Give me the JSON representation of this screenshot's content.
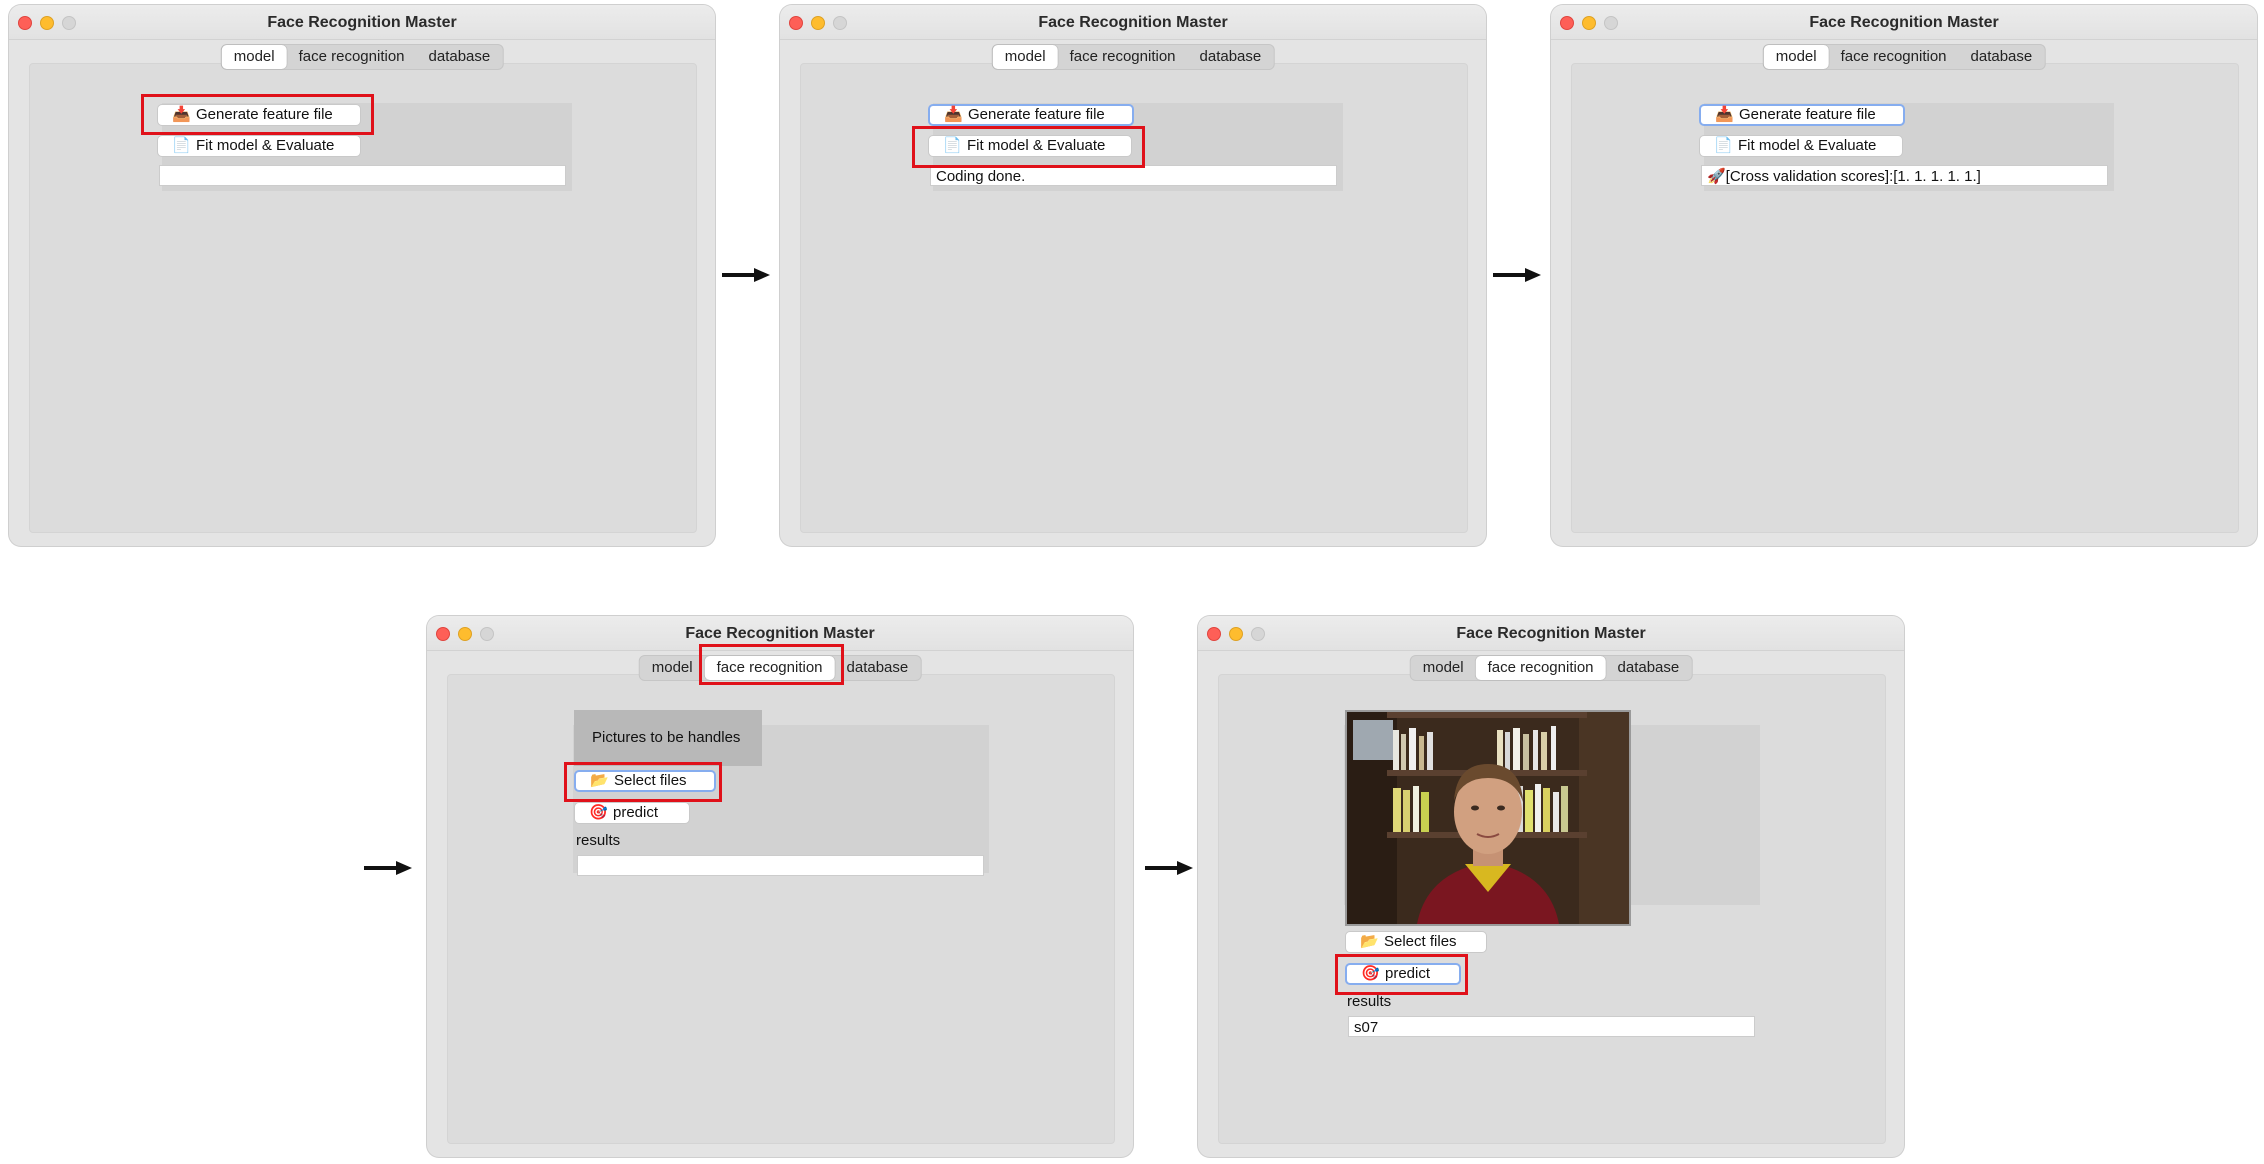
{
  "windows": [
    {
      "title": "Face Recognition Master",
      "tabs": [
        "model",
        "face recognition",
        "database"
      ],
      "selected_tab": "model",
      "generate_btn": {
        "label": "Generate feature file",
        "icon": "inbox-icon"
      },
      "fit_btn": {
        "label": "Fit model & Evaluate",
        "icon": "document-icon"
      },
      "output": ""
    },
    {
      "title": "Face Recognition Master",
      "tabs": [
        "model",
        "face recognition",
        "database"
      ],
      "selected_tab": "model",
      "generate_btn": {
        "label": "Generate feature file",
        "icon": "inbox-icon"
      },
      "fit_btn": {
        "label": "Fit model & Evaluate",
        "icon": "document-icon"
      },
      "output": "Coding done."
    },
    {
      "title": "Face Recognition Master",
      "tabs": [
        "model",
        "face recognition",
        "database"
      ],
      "selected_tab": "model",
      "generate_btn": {
        "label": "Generate feature file",
        "icon": "inbox-icon"
      },
      "fit_btn": {
        "label": "Fit model & Evaluate",
        "icon": "document-icon"
      },
      "output": "🚀[Cross validation scores]:[1. 1. 1. 1. 1.]"
    },
    {
      "title": "Face Recognition Master",
      "tabs": [
        "model",
        "face recognition",
        "database"
      ],
      "selected_tab": "face recognition",
      "picture_placeholder": "Pictures to be handles",
      "select_btn": {
        "label": "Select files",
        "icon": "folder-icon"
      },
      "predict_btn": {
        "label": "predict",
        "icon": "target-icon"
      },
      "results_label": "results",
      "results_value": ""
    },
    {
      "title": "Face Recognition Master",
      "tabs": [
        "model",
        "face recognition",
        "database"
      ],
      "selected_tab": "face recognition",
      "select_btn": {
        "label": "Select files",
        "icon": "folder-icon"
      },
      "predict_btn": {
        "label": "predict",
        "icon": "target-icon"
      },
      "results_label": "results",
      "results_value": "s07"
    }
  ],
  "colors": {
    "highlight": "#e0111a",
    "focus_ring": "#86adef"
  }
}
